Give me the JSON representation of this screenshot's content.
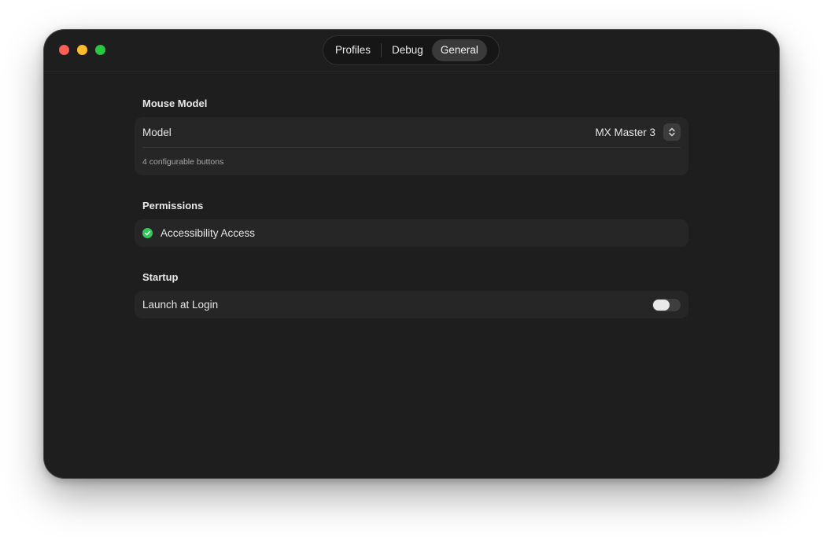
{
  "tabs": [
    {
      "label": "Profiles",
      "active": false
    },
    {
      "label": "Debug",
      "active": false
    },
    {
      "label": "General",
      "active": true
    }
  ],
  "mouse_model": {
    "section_title": "Mouse Model",
    "model_label": "Model",
    "selected_model": "MX Master 3",
    "description": "4 configurable buttons"
  },
  "permissions": {
    "section_title": "Permissions",
    "accessibility_label": "Accessibility Access",
    "status_icon": "checkmark-circle-icon",
    "status_color": "#32c85a"
  },
  "startup": {
    "section_title": "Startup",
    "launch_label": "Launch at Login",
    "launch_enabled": false
  },
  "colors": {
    "window_bg": "#1e1e1e",
    "card_bg": "#262626",
    "close": "#ff5f57",
    "minimize": "#febc2e",
    "zoom": "#28c840"
  }
}
